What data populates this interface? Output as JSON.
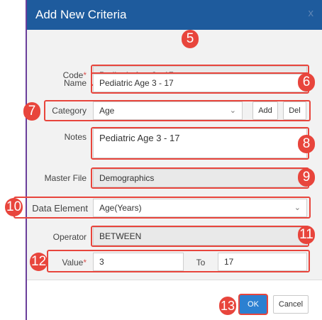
{
  "dialog": {
    "title": "Add New Criteria",
    "close_glyph": "x"
  },
  "form": {
    "code": {
      "label": "Code",
      "required_mark": "*",
      "value": "Pediatric Age 3 - 17"
    },
    "name": {
      "label": "Name",
      "value": "Pediatric Age 3 - 17"
    },
    "category": {
      "label": "Category",
      "value": "Age",
      "add_label": "Add",
      "del_label": "Del"
    },
    "notes": {
      "label": "Notes",
      "value": "Pediatric Age 3 - 17"
    },
    "master_file": {
      "label": "Master File",
      "value": "Demographics"
    },
    "data_element": {
      "label": "Data Element",
      "value": "Age(Years)"
    },
    "operator": {
      "label": "Operator",
      "value": "BETWEEN"
    },
    "value": {
      "label": "Value",
      "required_mark": "*",
      "from": "3",
      "to_label": "To",
      "to": "17"
    }
  },
  "footer": {
    "ok_label": "OK",
    "cancel_label": "Cancel"
  },
  "annotations": {
    "n5": "5",
    "n6": "6",
    "n7": "7",
    "n8": "8",
    "n9": "9",
    "n10": "10",
    "n11": "11",
    "n12": "12",
    "n13": "13"
  },
  "colors": {
    "title_bar": "#1e5b9d",
    "annotation": "#e8453c",
    "primary_button": "#2c80d1"
  },
  "icons": {
    "dropdown": "chevron-down-icon"
  }
}
